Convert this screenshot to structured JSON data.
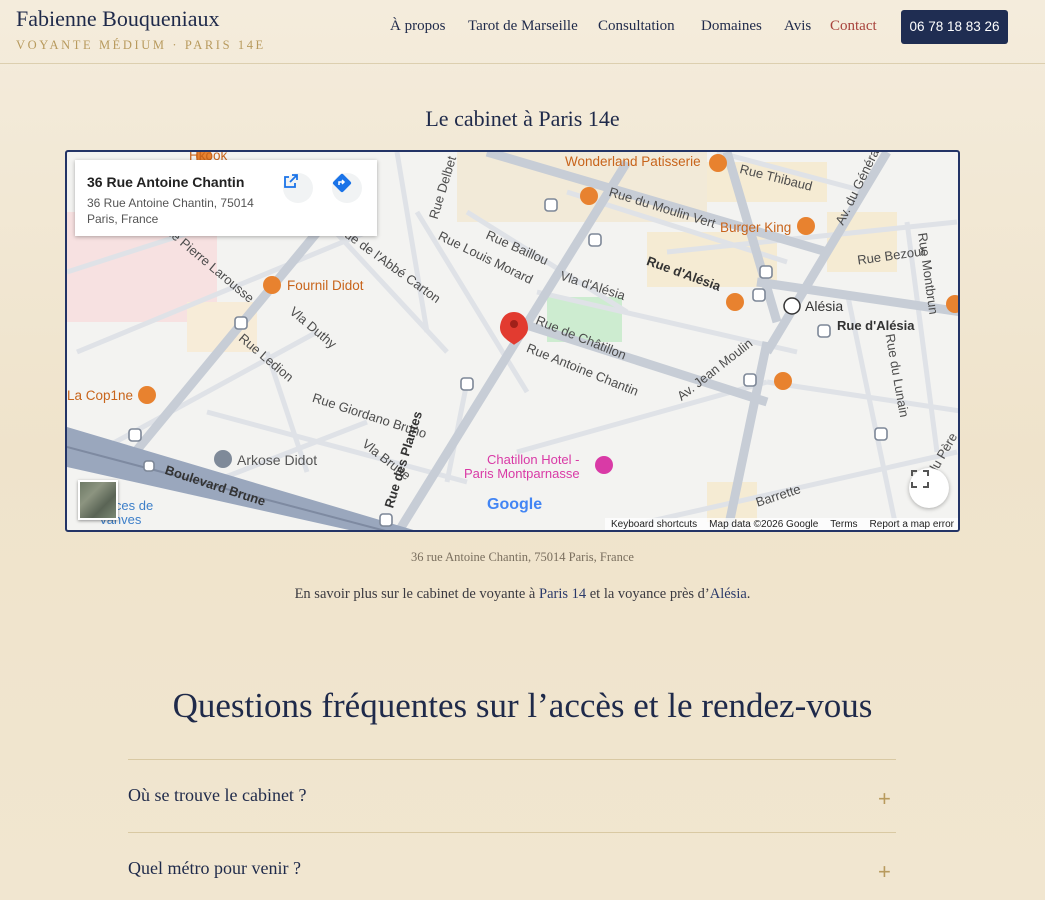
{
  "header": {
    "brand_name": "Fabienne Bouqueniaux",
    "brand_subtitle": "VOYANTE MÉDIUM · PARIS 14E",
    "nav": [
      "À propos",
      "Tarot de Marseille",
      "Consultation",
      "Domaines",
      "Avis",
      "Contact"
    ],
    "active_nav": "Contact",
    "phone": "06 78 18 83 26"
  },
  "cabinet": {
    "title": "Le cabinet à Paris 14e",
    "caption": "36 rue Antoine Chantin, 75014 Paris, France",
    "more_prefix": "En savoir plus sur le cabinet de voyante à ",
    "more_link1": "Paris 14",
    "more_middle": " et la voyance près d’",
    "more_link2": "Alésia",
    "more_suffix": "."
  },
  "map": {
    "card_title": "36 Rue Antoine Chantin",
    "card_addr1": "36 Rue Antoine Chantin, 75014",
    "card_addr2": "Paris, France",
    "pois": {
      "wonderland": "Wonderland Patisserie",
      "burger_king": "Burger King",
      "fournil": "Fournil Didot",
      "cop1ne": "La Cop1ne",
      "arkose": "Arkose Didot",
      "chatillon1": "Chatillon Hotel -",
      "chatillon2": "Paris Montparnasse",
      "alesia": "Alésia",
      "hkook": "Hkook",
      "puces1": "Puces de",
      "puces2": "Vanves"
    },
    "streets": {
      "thibaud": "Rue Thibaud",
      "moulin_vert": "Rue du Moulin Vert",
      "baillou": "Rue Baillou",
      "louis_morard": "Rue Louis Morard",
      "alesia_via": "Vla d'Alésia",
      "rue_alesia": "Rue d'Alésia",
      "rue_alesia2": "Rue d'Alésia",
      "bezout": "Rue Bezout",
      "montbrun": "Rue Montbrun",
      "delbet": "Rue Delbet",
      "abbe_carton": "Rue de l'Abbé Carton",
      "larousse": "Rue Pierre Larousse",
      "duthy": "Vla Duthy",
      "chatillon": "Rue de Châtillon",
      "antoine_chantin": "Rue Antoine Chantin",
      "jean_moulin": "Av. Jean Moulin",
      "ledion": "Rue Ledion",
      "giordano": "Rue Giordano Bruno",
      "brune": "Vla Brune",
      "plantes": "Rue des Plantes",
      "boulevard_brune": "Boulevard Brune",
      "lunain": "Rue du Lunain",
      "general": "Av. du Général",
      "pere": "Rue du Père",
      "barrette": "Barrette"
    },
    "attribution": [
      "Keyboard shortcuts",
      "Map data ©2026 Google",
      "Terms",
      "Report a map error"
    ],
    "google": "Google"
  },
  "faq": {
    "title": "Questions fréquentes sur l’accès et le rendez-vous",
    "items": [
      {
        "q": "Où se trouve le cabinet ?",
        "icon": "+"
      },
      {
        "q": "Quel métro pour venir ?",
        "icon": "+"
      }
    ]
  }
}
